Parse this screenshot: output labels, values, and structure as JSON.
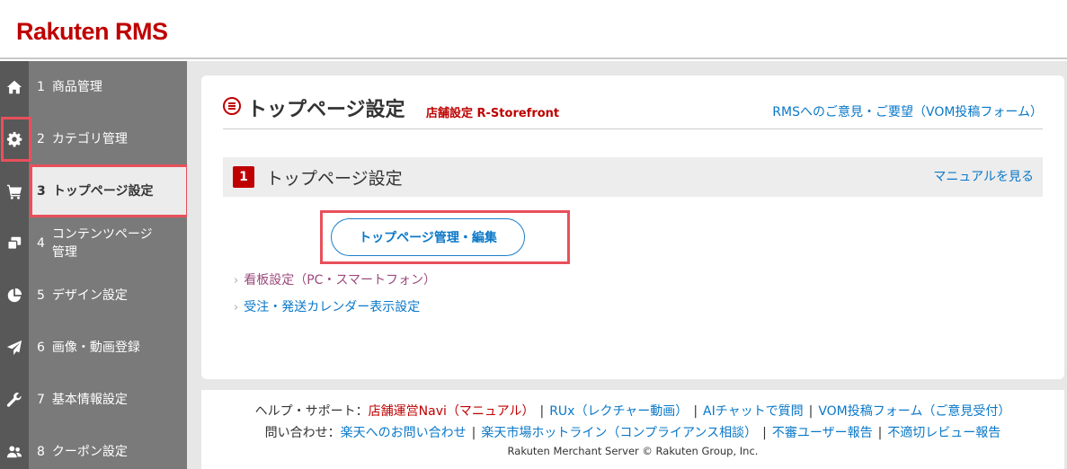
{
  "header": {
    "logo": "Rakuten RMS"
  },
  "sidebar": {
    "items": [
      {
        "num": "1",
        "label": "商品管理",
        "icon": "home-icon"
      },
      {
        "num": "2",
        "label": "カテゴリ管理",
        "icon": "gear-icon"
      },
      {
        "num": "3",
        "label": "トップページ設定",
        "icon": "cart-icon",
        "active": true
      },
      {
        "num": "4",
        "label": "コンテンツページ管理",
        "icon": "pages-icon"
      },
      {
        "num": "5",
        "label": "デザイン設定",
        "icon": "pie-chart-icon"
      },
      {
        "num": "6",
        "label": "画像・動画登録",
        "icon": "paper-plane-icon"
      },
      {
        "num": "7",
        "label": "基本情報設定",
        "icon": "tools-icon"
      },
      {
        "num": "8",
        "label": "クーポン設定",
        "icon": "users-icon"
      }
    ]
  },
  "main": {
    "title": "トップページ設定",
    "shop_setting": "店舗設定 R-Storefront",
    "feedback_link": "RMSへのご意見・ご要望（VOM投稿フォーム）",
    "section": {
      "num": "1",
      "title": "トップページ設定",
      "manual_link": "マニュアルを見る"
    },
    "primary_button": "トップページ管理・編集",
    "links": [
      {
        "label": "看板設定（PC・スマートフォン）",
        "visited": true
      },
      {
        "label": "受注・発送カレンダー表示設定",
        "visited": false
      }
    ]
  },
  "footer": {
    "help_label": "ヘルプ・サポート：",
    "help_links": [
      "店舗運営Navi（マニュアル）",
      "RUx（レクチャー動画）",
      "AIチャットで質問",
      "VOM投稿フォーム（ご意見受付）"
    ],
    "contact_label": "問い合わせ：",
    "contact_links": [
      "楽天へのお問い合わせ",
      "楽天市場ホットライン（コンプライアンス相談）",
      "不審ユーザー報告",
      "不適切レビュー報告"
    ],
    "copyright": "Rakuten Merchant Server © Rakuten Group, Inc."
  },
  "colors": {
    "brand": "#bf0000",
    "link": "#0a78c8",
    "highlight": "#e8505b"
  }
}
